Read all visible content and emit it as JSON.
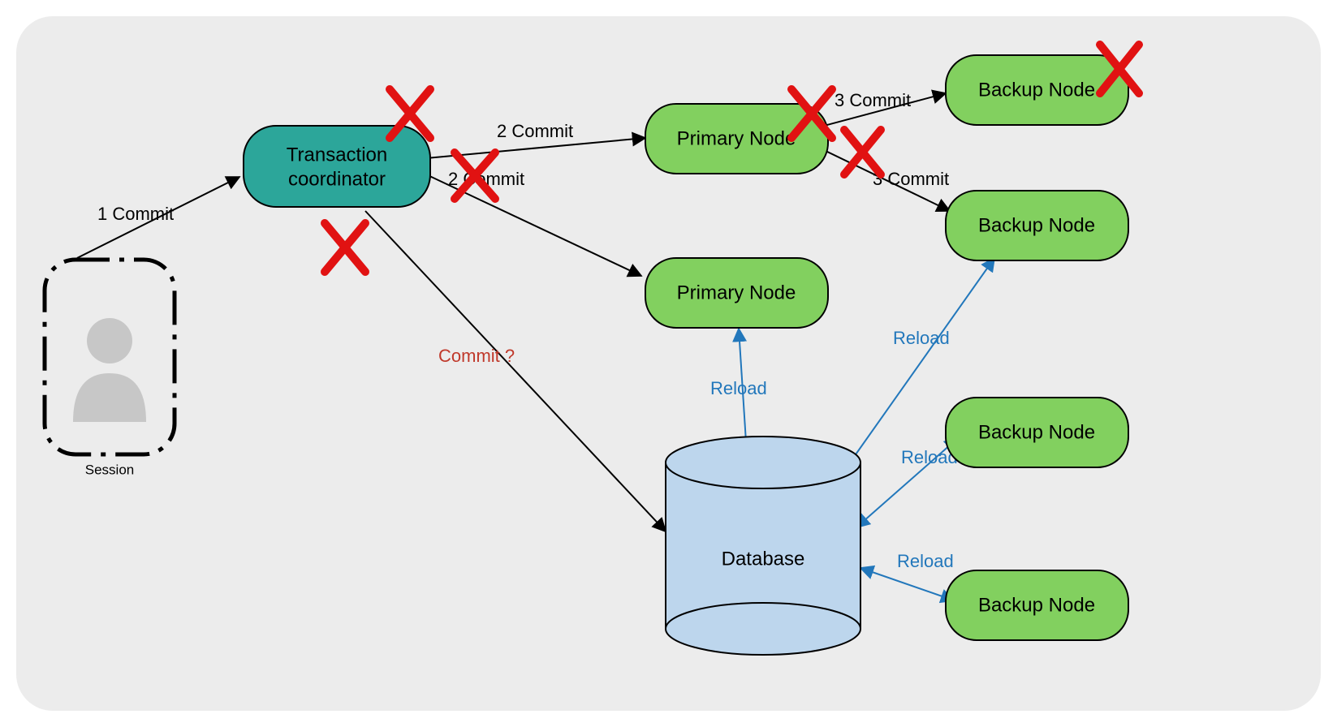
{
  "nodes": {
    "session": {
      "label": "Session"
    },
    "coordinator": {
      "line1": "Transaction",
      "line2": "coordinator"
    },
    "primary1": {
      "label": "Primary Node"
    },
    "primary2": {
      "label": "Primary Node"
    },
    "backup_top1": {
      "label": "Backup Node"
    },
    "backup_top2": {
      "label": "Backup Node"
    },
    "backup_bot1": {
      "label": "Backup Node"
    },
    "backup_bot2": {
      "label": "Backup Node"
    },
    "database": {
      "label": "Database"
    }
  },
  "edges": {
    "e1": {
      "label": "1 Commit"
    },
    "e2a": {
      "label": "2 Commit"
    },
    "e2b": {
      "label": "2 Commit"
    },
    "e3a": {
      "label": "3 Commit"
    },
    "e3b": {
      "label": "3 Commit"
    },
    "commitq": {
      "label": "Commit ?"
    },
    "reload1": {
      "label": "Reload"
    },
    "reload2": {
      "label": "Reload"
    },
    "reload3": {
      "label": "Reload"
    },
    "reload4": {
      "label": "Reload"
    }
  },
  "colors": {
    "bg_panel": "#ececec",
    "coordinator_fill": "#2ca69a",
    "node_fill": "#82d05f",
    "db_fill": "#bdd6ed",
    "black": "#000000",
    "blue": "#2277bb",
    "red": "#d22222",
    "redx": "#e11212",
    "person": "#c7c7c7"
  }
}
